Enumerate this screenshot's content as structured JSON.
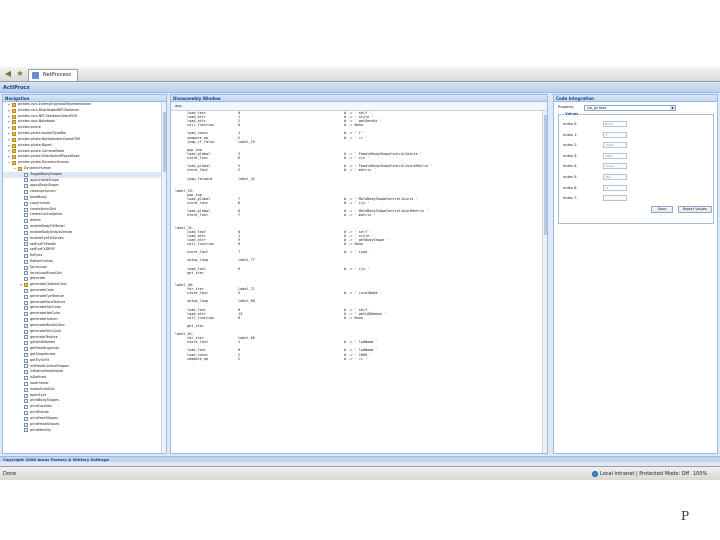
{
  "browser": {
    "tab_title": "NetProcesx"
  },
  "app": {
    "title": "ActiProcx"
  },
  "navigation": {
    "title": "Navigation",
    "items": [
      {
        "label": "pirates.rscs.EnemyEngineAIRepresentation",
        "indent": 0,
        "icon": "folder",
        "expander": "+"
      },
      {
        "label": "pirates.rscs.DistributedNPCBehavior",
        "indent": 0,
        "icon": "folder",
        "expander": "+"
      },
      {
        "label": "pirates.rscs.NPCSkeletonGameFSM",
        "indent": 0,
        "icon": "folder",
        "expander": "+"
      },
      {
        "label": "pirates.rscs.Notebook",
        "indent": 0,
        "icon": "folder",
        "expander": "+"
      },
      {
        "label": "pirates.scene",
        "indent": 0,
        "icon": "folder",
        "expander": "+"
      },
      {
        "label": "pirates.pirate.AvatarTypeBar",
        "indent": 0,
        "icon": "folder",
        "expander": "+"
      },
      {
        "label": "pirates.pirate.BattleAvatarGameFSM",
        "indent": 0,
        "icon": "folder",
        "expander": "+"
      },
      {
        "label": "pirates.pirate.Biped",
        "indent": 0,
        "icon": "folder",
        "expander": "+"
      },
      {
        "label": "pirates.pirate.CameraMode",
        "indent": 0,
        "icon": "folder",
        "expander": "+"
      },
      {
        "label": "pirates.pirate.DistributedPlayerBase",
        "indent": 0,
        "icon": "folder",
        "expander": "+"
      },
      {
        "label": "pirates.pirate.DynamicHuman",
        "indent": 0,
        "icon": "folder",
        "expander": "−"
      },
      {
        "label": "DynamicHuman",
        "indent": 1,
        "icon": "folder",
        "expander": "−"
      },
      {
        "label": "ToggleBodyShapes",
        "indent": 2,
        "icon": "file",
        "expander": ""
      },
      {
        "label": "applyHeadShape",
        "indent": 2,
        "icon": "file",
        "expander": ""
      },
      {
        "label": "applyBodyShape",
        "indent": 2,
        "icon": "file",
        "expander": ""
      },
      {
        "label": "cleanupHuman",
        "indent": 2,
        "icon": "file",
        "expander": ""
      },
      {
        "label": "bakeBody",
        "indent": 2,
        "icon": "file",
        "expander": ""
      },
      {
        "label": "copyHuman",
        "indent": 2,
        "icon": "file",
        "expander": ""
      },
      {
        "label": "createAnimDict",
        "indent": 2,
        "icon": "file",
        "expander": ""
      },
      {
        "label": "createControlJoints",
        "indent": 2,
        "icon": "file",
        "expander": ""
      },
      {
        "label": "delete",
        "indent": 2,
        "icon": "file",
        "expander": ""
      },
      {
        "label": "enableBodyFXModel",
        "indent": 2,
        "icon": "file",
        "expander": ""
      },
      {
        "label": "enableBodyShapeZeroes",
        "indent": 2,
        "icon": "file",
        "expander": ""
      },
      {
        "label": "enableEyeFXZeroes",
        "indent": 2,
        "icon": "file",
        "expander": ""
      },
      {
        "label": "setEyeFXModel",
        "indent": 2,
        "icon": "file",
        "expander": ""
      },
      {
        "label": "setEyeFXDROP",
        "indent": 2,
        "icon": "file",
        "expander": ""
      },
      {
        "label": "fixEyes",
        "indent": 2,
        "icon": "file",
        "expander": ""
      },
      {
        "label": "flattenHuman",
        "indent": 2,
        "icon": "file",
        "expander": ""
      },
      {
        "label": "forceLoad",
        "indent": 2,
        "icon": "file",
        "expander": ""
      },
      {
        "label": "forceLoadFromDict",
        "indent": 2,
        "icon": "file",
        "expander": ""
      },
      {
        "label": "generate",
        "indent": 2,
        "icon": "file",
        "expander": ""
      },
      {
        "label": "generateClothesColor",
        "indent": 2,
        "icon": "folder",
        "expander": "+"
      },
      {
        "label": "generateColor",
        "indent": 2,
        "icon": "file",
        "expander": ""
      },
      {
        "label": "generateEyeTexture",
        "indent": 2,
        "icon": "file",
        "expander": ""
      },
      {
        "label": "generateFaceTexture",
        "indent": 2,
        "icon": "file",
        "expander": ""
      },
      {
        "label": "generateHairColor",
        "indent": 2,
        "icon": "file",
        "expander": ""
      },
      {
        "label": "generateHatColor",
        "indent": 2,
        "icon": "file",
        "expander": ""
      },
      {
        "label": "generateHuman",
        "indent": 2,
        "icon": "file",
        "expander": ""
      },
      {
        "label": "generateMouthColor",
        "indent": 2,
        "icon": "file",
        "expander": ""
      },
      {
        "label": "generateSkinColor",
        "indent": 2,
        "icon": "file",
        "expander": ""
      },
      {
        "label": "generateTexture",
        "indent": 2,
        "icon": "file",
        "expander": ""
      },
      {
        "label": "getJointNames",
        "indent": 2,
        "icon": "file",
        "expander": ""
      },
      {
        "label": "getHeadingJoints",
        "indent": 2,
        "icon": "file",
        "expander": ""
      },
      {
        "label": "getShapeIndex",
        "indent": 2,
        "icon": "file",
        "expander": ""
      },
      {
        "label": "getTryOnFit",
        "indent": 2,
        "icon": "file",
        "expander": ""
      },
      {
        "label": "initHeadControlShapes",
        "indent": 2,
        "icon": "file",
        "expander": ""
      },
      {
        "label": "initializeModelNode",
        "indent": 2,
        "icon": "file",
        "expander": ""
      },
      {
        "label": "isDefined",
        "indent": 2,
        "icon": "file",
        "expander": ""
      },
      {
        "label": "loadHuman",
        "indent": 2,
        "icon": "file",
        "expander": ""
      },
      {
        "label": "makeAnimDict",
        "indent": 2,
        "icon": "file",
        "expander": ""
      },
      {
        "label": "openEyes",
        "indent": 2,
        "icon": "file",
        "expander": ""
      },
      {
        "label": "printBodyShapes",
        "indent": 2,
        "icon": "file",
        "expander": ""
      },
      {
        "label": "printControls",
        "indent": 2,
        "icon": "file",
        "expander": ""
      },
      {
        "label": "printExtras",
        "indent": 2,
        "icon": "file",
        "expander": ""
      },
      {
        "label": "printFaceShapes",
        "indent": 2,
        "icon": "file",
        "expander": ""
      },
      {
        "label": "printHeadShapes",
        "indent": 2,
        "icon": "file",
        "expander": ""
      },
      {
        "label": "printIdentity",
        "indent": 2,
        "icon": "file",
        "expander": ""
      }
    ]
  },
  "disassembly": {
    "title": "Disassembly Window",
    "subheader": "apx",
    "lines": [
      {
        "label": "",
        "op": "load_fast",
        "arg": "0",
        "comment": "# -> ' self '"
      },
      {
        "label": "",
        "op": "load_attr",
        "arg": "1",
        "comment": "# -> ' style '"
      },
      {
        "label": "",
        "op": "load_attr",
        "arg": "2",
        "comment": "# -> ' getGender '"
      },
      {
        "label": "",
        "op": "call_function",
        "arg": "0",
        "comment": "# -> None"
      },
      {
        "label": "",
        "op": "",
        "arg": "",
        "comment": ""
      },
      {
        "label": "",
        "op": "load_const",
        "arg": "1",
        "comment": "# -> ' f '"
      },
      {
        "label": "",
        "op": "compare_op",
        "arg": "2",
        "comment": "# -> ' == '"
      },
      {
        "label": "",
        "op": "jump_if_false",
        "arg": "label_25",
        "comment": ""
      },
      {
        "label": "",
        "op": "",
        "arg": "",
        "comment": ""
      },
      {
        "label": "",
        "op": "pop_top",
        "arg": "",
        "comment": ""
      },
      {
        "label": "",
        "op": "load_global",
        "arg": "3",
        "comment": "# -> ' FemaleBodyShapeControlJoints '"
      },
      {
        "label": "",
        "op": "store_fast",
        "arg": "6",
        "comment": "# -> ' cjs '"
      },
      {
        "label": "",
        "op": "",
        "arg": "",
        "comment": ""
      },
      {
        "label": "",
        "op": "load_global",
        "arg": "5",
        "comment": "# -> ' FemaleBodyShapeControlJointMatrix '"
      },
      {
        "label": "",
        "op": "store_fast",
        "arg": "2",
        "comment": "# -> ' matrix '"
      },
      {
        "label": "",
        "op": "",
        "arg": "",
        "comment": ""
      },
      {
        "label": "",
        "op": "jump_forward",
        "arg": "label_32",
        "comment": ""
      },
      {
        "label": "",
        "op": "",
        "arg": "",
        "comment": ""
      },
      {
        "label": "",
        "op": "",
        "arg": "",
        "comment": ""
      },
      {
        "label": "label_25:",
        "op": "",
        "arg": "",
        "comment": ""
      },
      {
        "label": "",
        "op": "pop_top",
        "arg": "",
        "comment": ""
      },
      {
        "label": "",
        "op": "load_global",
        "arg": "7",
        "comment": "# -> ' MaleBodyShapeControlJoints '"
      },
      {
        "label": "",
        "op": "store_fast",
        "arg": "6",
        "comment": "# -> ' cjs '"
      },
      {
        "label": "",
        "op": "",
        "arg": "",
        "comment": ""
      },
      {
        "label": "",
        "op": "load_global",
        "arg": "8",
        "comment": "# -> ' MaleBodyShapeControlJointMatrix '"
      },
      {
        "label": "",
        "op": "store_fast",
        "arg": "7",
        "comment": "# -> ' matrix '"
      },
      {
        "label": "",
        "op": "",
        "arg": "",
        "comment": ""
      },
      {
        "label": "",
        "op": "",
        "arg": "",
        "comment": ""
      },
      {
        "label": "label_32:",
        "op": "",
        "arg": "",
        "comment": ""
      },
      {
        "label": "",
        "op": "load_fast",
        "arg": "0",
        "comment": "# -> ' self '"
      },
      {
        "label": "",
        "op": "load_attr",
        "arg": "1",
        "comment": "# -> ' style '"
      },
      {
        "label": "",
        "op": "load_attr",
        "arg": "9",
        "comment": "# -> ' getBodyShape '"
      },
      {
        "label": "",
        "op": "call_function",
        "arg": "0",
        "comment": "# -> None"
      },
      {
        "label": "",
        "op": "",
        "arg": "",
        "comment": ""
      },
      {
        "label": "",
        "op": "store_fast",
        "arg": "7",
        "comment": "# -> ' type '"
      },
      {
        "label": "",
        "op": "",
        "arg": "",
        "comment": ""
      },
      {
        "label": "",
        "op": "setup_loop",
        "arg": "label_77",
        "comment": ""
      },
      {
        "label": "",
        "op": "",
        "arg": "",
        "comment": ""
      },
      {
        "label": "",
        "op": "load_fast",
        "arg": "6",
        "comment": "# -> ' cjs '"
      },
      {
        "label": "",
        "op": "get_iter",
        "arg": "",
        "comment": ""
      },
      {
        "label": "",
        "op": "",
        "arg": "",
        "comment": ""
      },
      {
        "label": "",
        "op": "",
        "arg": "",
        "comment": ""
      },
      {
        "label": "label_48:",
        "op": "",
        "arg": "",
        "comment": ""
      },
      {
        "label": "",
        "op": "for_iter",
        "arg": "label_71",
        "comment": ""
      },
      {
        "label": "",
        "op": "store_fast",
        "arg": "5",
        "comment": "# -> ' jointName '"
      },
      {
        "label": "",
        "op": "",
        "arg": "",
        "comment": ""
      },
      {
        "label": "",
        "op": "setup_loop",
        "arg": "label_68",
        "comment": ""
      },
      {
        "label": "",
        "op": "",
        "arg": "",
        "comment": ""
      },
      {
        "label": "",
        "op": "load_fast",
        "arg": "0",
        "comment": "# -> ' self '"
      },
      {
        "label": "",
        "op": "load_attr",
        "arg": "13",
        "comment": "# -> ' getLODNames '"
      },
      {
        "label": "",
        "op": "call_function",
        "arg": "0",
        "comment": "# -> None"
      },
      {
        "label": "",
        "op": "",
        "arg": "",
        "comment": ""
      },
      {
        "label": "",
        "op": "get_iter",
        "arg": "",
        "comment": ""
      },
      {
        "label": "",
        "op": "",
        "arg": "",
        "comment": ""
      },
      {
        "label": "label_61:",
        "op": "",
        "arg": "",
        "comment": ""
      },
      {
        "label": "",
        "op": "for_iter",
        "arg": "label_66",
        "comment": ""
      },
      {
        "label": "",
        "op": "store_fast",
        "arg": "1",
        "comment": "# -> ' lodName '"
      },
      {
        "label": "",
        "op": "",
        "arg": "",
        "comment": ""
      },
      {
        "label": "",
        "op": "load_fast",
        "arg": "0",
        "comment": "# -> ' lodName '"
      },
      {
        "label": "",
        "op": "load_const",
        "arg": "2",
        "comment": "# -> ' 2000 '"
      },
      {
        "label": "",
        "op": "compare_op",
        "arg": "2",
        "comment": "# -> ' == '"
      }
    ]
  },
  "code_integration": {
    "title": "Code Integration",
    "property_label": "Property:",
    "property_value": "zip_pirates",
    "values_legend": "Values",
    "indices": [
      {
        "label": "Index 0:",
        "value": "None"
      },
      {
        "label": "Index 1:",
        "value": "'f'"
      },
      {
        "label": "Index 2:",
        "value": "'male'"
      },
      {
        "label": "Index 3:",
        "value": "'fate'"
      },
      {
        "label": "Index 4:",
        "value": "'lower'"
      },
      {
        "label": "Index 5:",
        "value": "'ibe'"
      },
      {
        "label": "Index 6:",
        "value": "-1"
      },
      {
        "label": "Index 7:",
        "value": ""
      }
    ],
    "save_label": "Save",
    "reject_label": "Reject Values"
  },
  "footer": {
    "copyright": "Copyright 2008 Aurac Factory & Military Softrage"
  },
  "status": {
    "left": "Done",
    "zone": "Local intranet | Protected Mode: Off",
    "zoom": "100%"
  },
  "page_number": "P"
}
